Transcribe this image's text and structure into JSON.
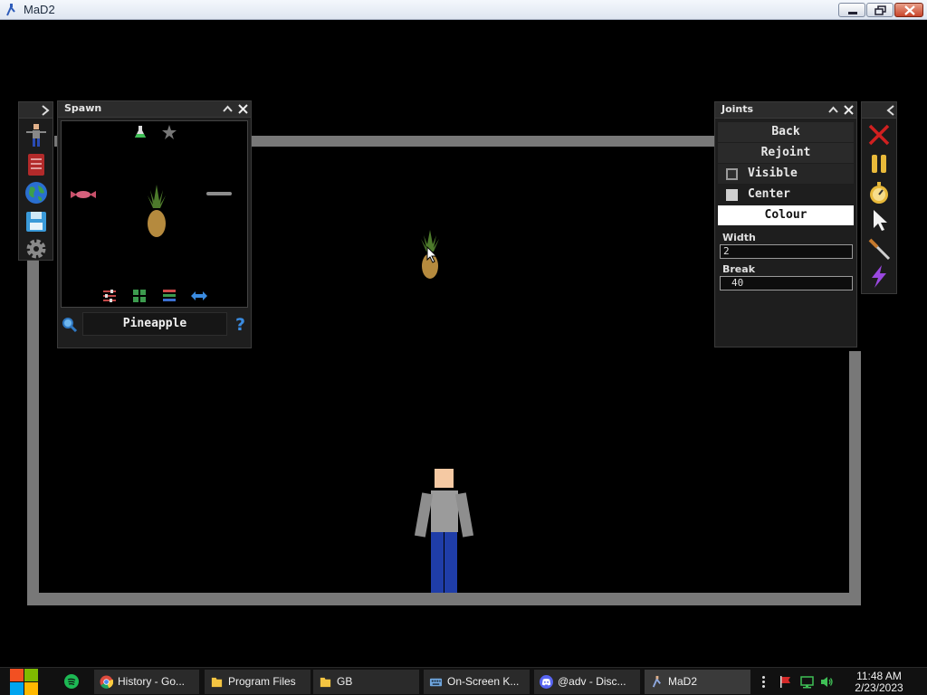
{
  "window": {
    "title": "MaD2"
  },
  "spawn_panel": {
    "title": "Spawn",
    "search_value": "Pineapple"
  },
  "joints_panel": {
    "title": "Joints",
    "back_label": "Back",
    "rejoint_label": "Rejoint",
    "visible_label": "Visible",
    "center_label": "Center",
    "colour_label": "Colour",
    "width_label": "Width",
    "width_value": "2",
    "break_label": "Break",
    "break_value": "40"
  },
  "taskbar": {
    "items": [
      {
        "label": "History - Go..."
      },
      {
        "label": "Program Files"
      },
      {
        "label": "GB"
      },
      {
        "label": "On-Screen K..."
      },
      {
        "label": "@adv - Disc..."
      },
      {
        "label": "MaD2"
      }
    ],
    "time": "11:48 AM",
    "date": "2/23/2023"
  },
  "icons": {
    "left_dock": [
      "ragdoll-icon",
      "book-icon",
      "globe-icon",
      "save-icon",
      "gear-icon"
    ],
    "right_dock": [
      "delete-icon",
      "pause-icon",
      "stopwatch-icon",
      "cursor-icon",
      "knife-icon",
      "lightning-icon"
    ]
  },
  "colors": {
    "background": "#000000",
    "wall": "#787878",
    "panel": "#1e1e1e",
    "taskbar": "#111111"
  }
}
